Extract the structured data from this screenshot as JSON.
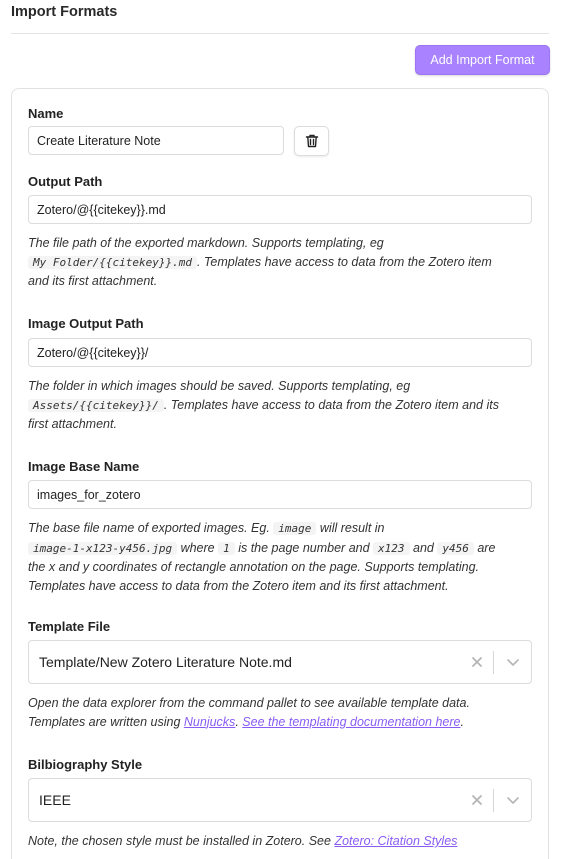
{
  "section": {
    "title": "Import Formats",
    "add_button": "Add Import Format"
  },
  "name": {
    "label": "Name",
    "value": "Create Literature Note"
  },
  "output_path": {
    "label": "Output Path",
    "value": "Zotero/@{{citekey}}.md",
    "desc_1": "The file path of the exported markdown. Supports templating, eg",
    "desc_code": "My Folder/{{citekey}}.md",
    "desc_2": ". Templates have access to data from the Zotero item",
    "desc_3": "and its first attachment."
  },
  "image_output_path": {
    "label": "Image Output Path",
    "value": "Zotero/@{{citekey}}/",
    "desc_1": "The folder in which images should be saved. Supports templating, eg",
    "desc_code": "Assets/{{citekey}}/",
    "desc_2": ". Templates have access to data from the Zotero item and its",
    "desc_3": "first attachment."
  },
  "image_base_name": {
    "label": "Image Base Name",
    "value": "images_for_zotero",
    "desc_1": "The base file name of exported images. Eg.",
    "code_image": "image",
    "desc_2": "will result in",
    "code_example": "image-1-x123-y456.jpg",
    "desc_3": "where",
    "code_1": "1",
    "desc_4": "is the page number and",
    "code_x": "x123",
    "desc_5": "and",
    "code_y": "y456",
    "desc_6": "are",
    "desc_7": "the x and y coordinates of rectangle annotation on the page. Supports templating.",
    "desc_8": "Templates have access to data from the Zotero item and its first attachment."
  },
  "template_file": {
    "label": "Template File",
    "value": "Template/New Zotero Literature Note.md",
    "desc_1": "Open the data explorer from the command pallet to see available template data.",
    "desc_2": "Templates are written using",
    "link_1": "Nunjucks",
    "link_2": "See the templating documentation here",
    "desc_period": "."
  },
  "bibliography_style": {
    "label": "Bilbiography Style",
    "value": "IEEE",
    "desc_1": "Note, the chosen style must be installed in Zotero. See",
    "link": "Zotero: Citation Styles"
  },
  "colors": {
    "accent": "#a882ff",
    "link": "#8a5cf5"
  },
  "icons": {
    "delete": "trash-icon",
    "clear": "close-icon",
    "dropdown": "chevron-down-icon"
  }
}
